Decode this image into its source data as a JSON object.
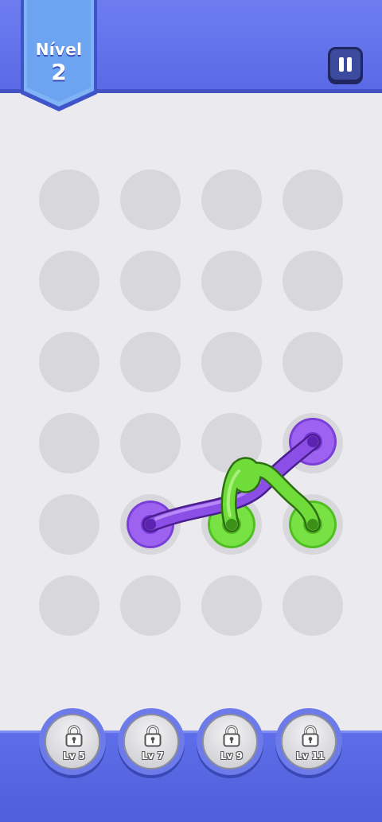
{
  "header": {
    "level_label": "Nível",
    "level_number": "2"
  },
  "controls": {
    "pause_icon": "pause-icon"
  },
  "board": {
    "rows": 6,
    "cols": 4,
    "colors": {
      "hole": "#d8d8dc",
      "purple": "#8b4fe8",
      "green": "#6fdc3a"
    }
  },
  "locked_levels": [
    {
      "label": "Lv 5",
      "icon": "lock-icon"
    },
    {
      "label": "Lv 7",
      "icon": "lock-icon"
    },
    {
      "label": "Lv 9",
      "icon": "lock-icon"
    },
    {
      "label": "Lv 11",
      "icon": "lock-icon"
    }
  ]
}
